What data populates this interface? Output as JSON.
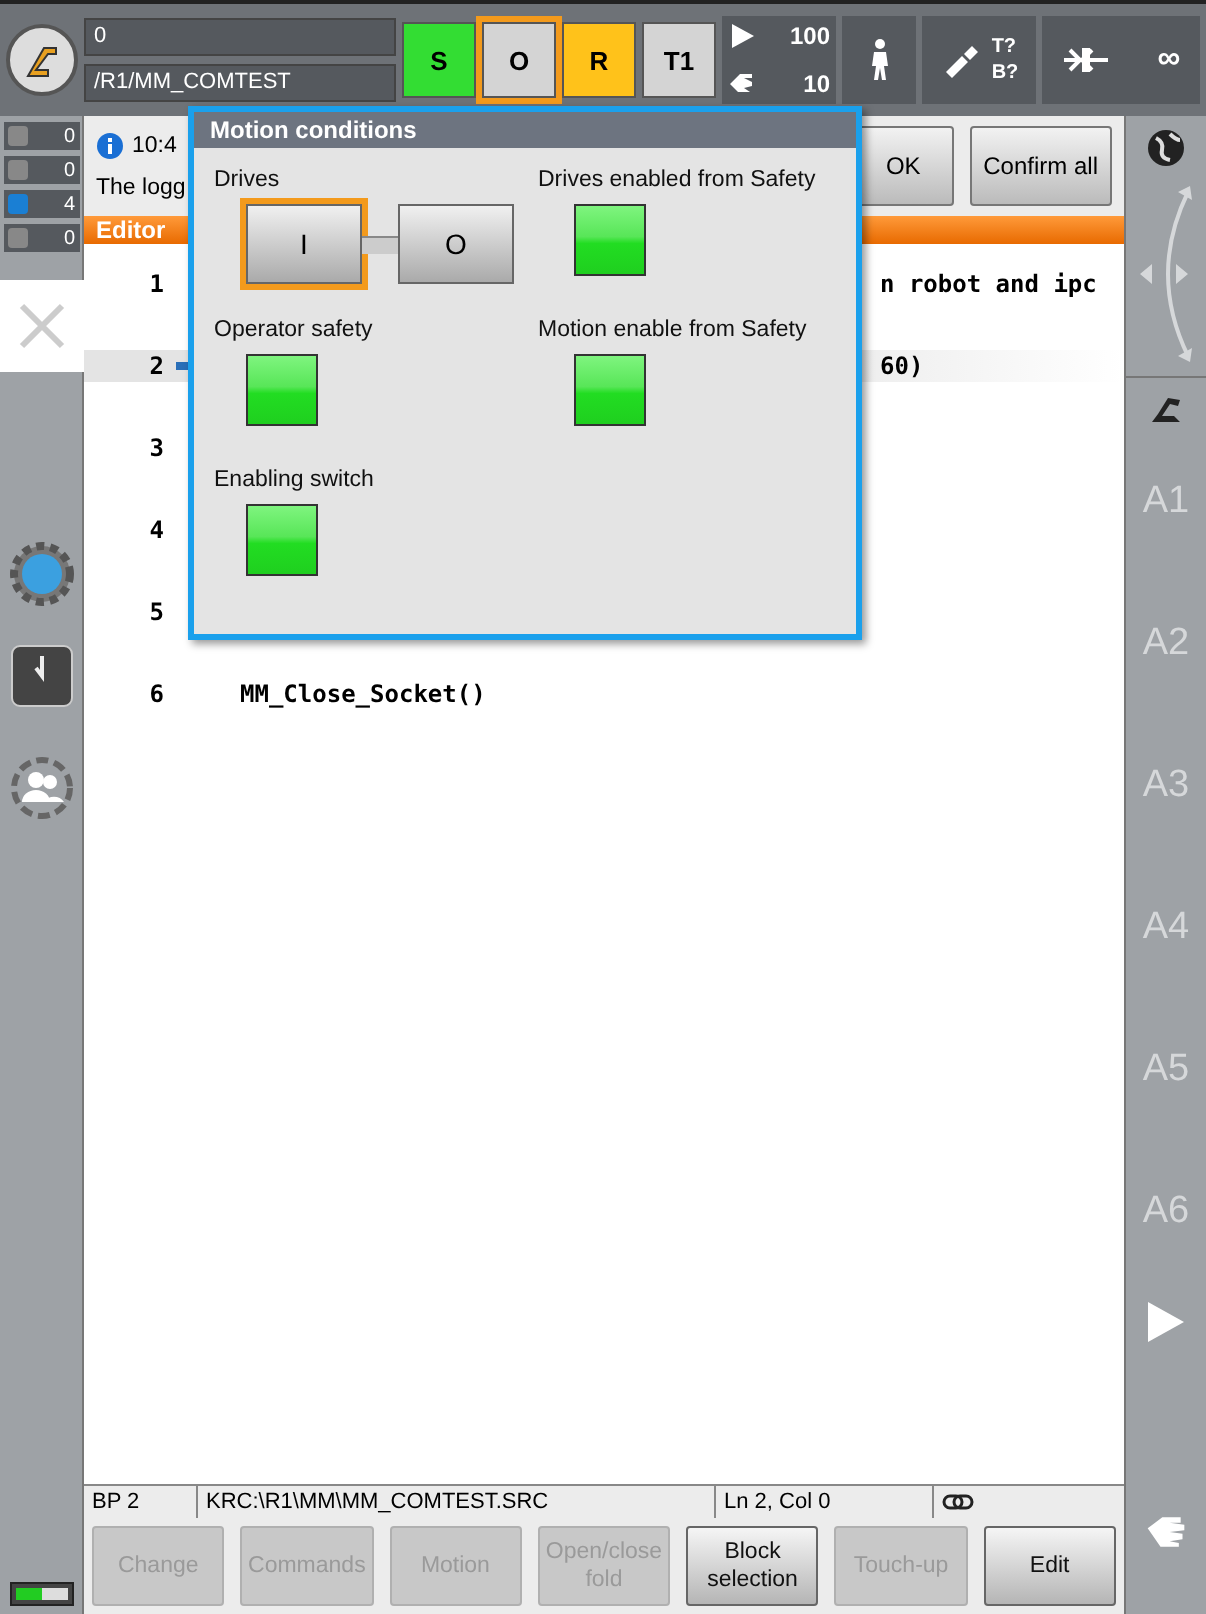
{
  "status_field": {
    "line_1": "0",
    "line_2": "/R1/MM_COMTEST"
  },
  "mode_buttons": [
    {
      "label": "S",
      "color": "#33dd33",
      "selected": false
    },
    {
      "label": "O",
      "color": "#d4d4d4",
      "selected": true
    },
    {
      "label": "R",
      "color": "#ffc21a",
      "selected": false
    },
    {
      "label": "T1",
      "color": "#d4d4d4",
      "selected": false
    }
  ],
  "override": {
    "program": "100",
    "jog": "10"
  },
  "tool_base": {
    "tool": "T?",
    "base": "B?"
  },
  "increment": "∞",
  "message_counters": [
    {
      "kind": "error",
      "count": "0"
    },
    {
      "kind": "warning",
      "count": "0"
    },
    {
      "kind": "info",
      "count": "4"
    },
    {
      "kind": "wait",
      "count": "0"
    }
  ],
  "message": {
    "time": "10:4",
    "text": "The logg"
  },
  "message_buttons": [
    "OK",
    "Confirm all"
  ],
  "editor": {
    "title": "Editor",
    "lines": [
      {
        "number": "1",
        "text": "n robot and ipc",
        "covered": true,
        "selected": false
      },
      {
        "number": "2",
        "text": "60)",
        "covered": true,
        "selected": true
      },
      {
        "number": "3",
        "selected": false
      },
      {
        "number": "4",
        "selected": false
      },
      {
        "number": "5",
        "selected": false
      },
      {
        "number": "6",
        "text": "MM_Close_Socket()",
        "covered": false,
        "selected": false
      }
    ]
  },
  "dialog": {
    "title": "Motion conditions",
    "drives": {
      "label": "Drives",
      "buttons": [
        {
          "label": "I",
          "selected": true
        },
        {
          "label": "O",
          "selected": false
        }
      ]
    },
    "indicators": [
      {
        "label": "Drives enabled from Safety",
        "on": true
      },
      {
        "label": "Operator safety",
        "on": true
      },
      {
        "label": "Motion enable from Safety",
        "on": true
      },
      {
        "label": "Enabling switch",
        "on": true
      }
    ]
  },
  "axis_keys": [
    "A1",
    "A2",
    "A3",
    "A4",
    "A5",
    "A6"
  ],
  "status_bar": [
    "BP 2",
    "KRC:\\R1\\MM\\MM_COMTEST.SRC",
    "Ln 2, Col 0"
  ],
  "softkeys": [
    {
      "label": "Change",
      "disabled": true
    },
    {
      "label": "Commands",
      "disabled": true
    },
    {
      "label": "Motion",
      "disabled": true
    },
    {
      "label": "Open/close fold",
      "disabled": true
    },
    {
      "label": "Block selection",
      "disabled": false
    },
    {
      "label": "Touch-up",
      "disabled": true
    },
    {
      "label": "Edit",
      "disabled": false
    }
  ]
}
